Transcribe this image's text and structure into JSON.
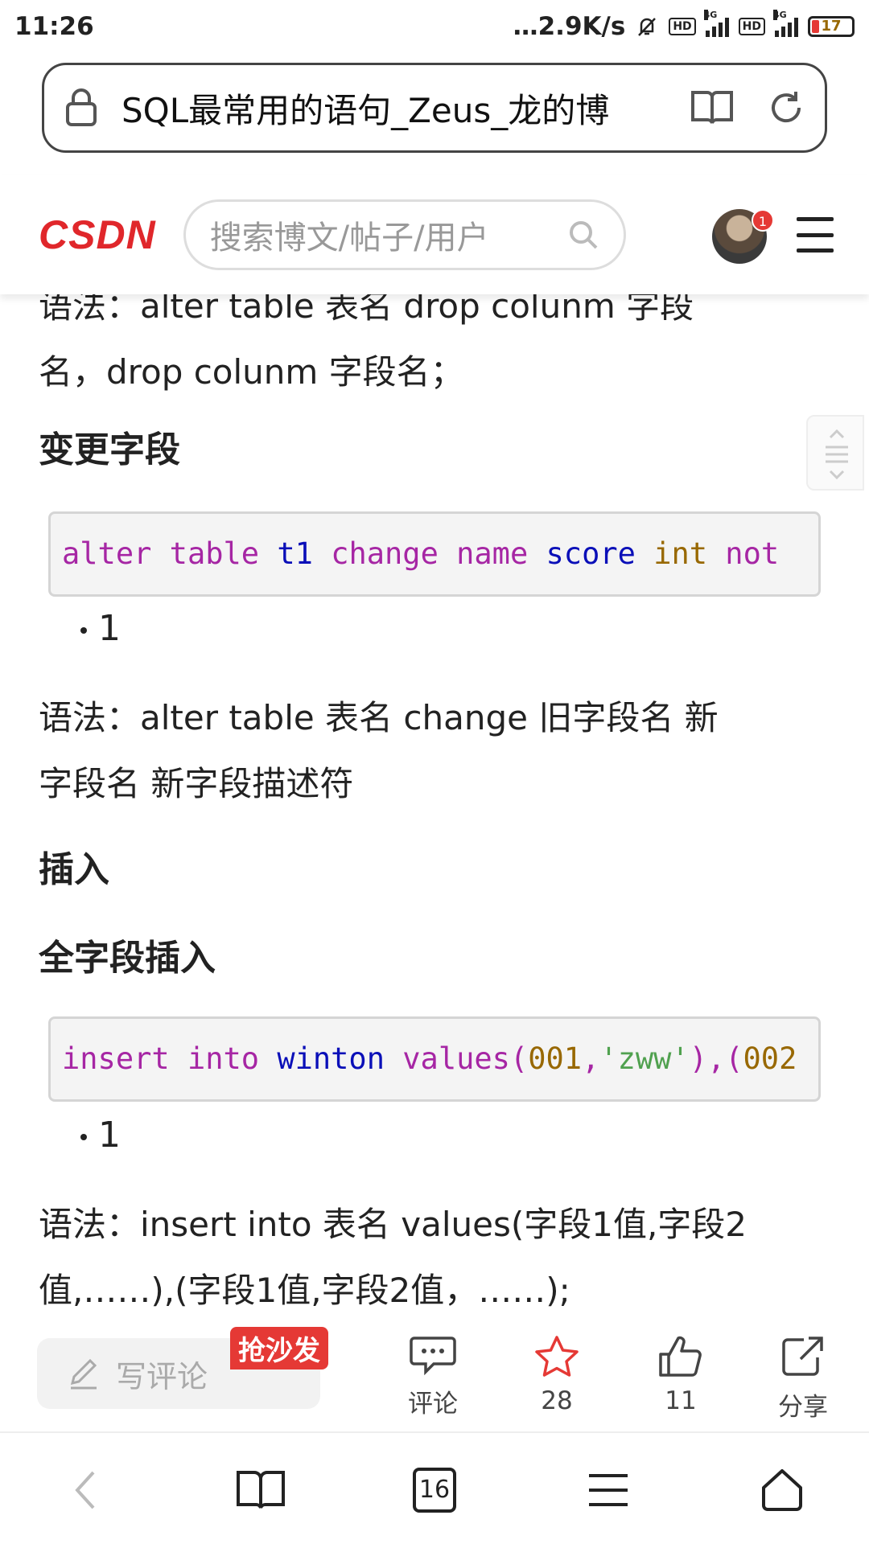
{
  "status_bar": {
    "time": "11:26",
    "net_speed": "2.9K/s",
    "hd1": "HD",
    "hd2": "HD",
    "net1": "4G",
    "net2": "4G",
    "battery": "17"
  },
  "browser": {
    "url_title": "SQL最常用的语句_Zeus_龙的博"
  },
  "csdn": {
    "logo": "CSDN",
    "search_placeholder": "搜索博文/帖子/用户",
    "notification_count": "1"
  },
  "article": {
    "drop_syntax_line1": "语法：alter table 表名 drop colunm 字段",
    "drop_syntax_line2": "名，drop colunm 字段名；",
    "heading_change": "变更字段",
    "code_change": {
      "t1": "alter",
      "t2": "table",
      "t3": "t1",
      "t4": "change",
      "t5": "name",
      "t6": "score",
      "t7": "int",
      "t8": "not"
    },
    "code_change_line": "1",
    "change_syntax_line1": "语法：alter table 表名 change 旧字段名 新",
    "change_syntax_line2": "字段名 新字段描述符",
    "heading_insert": "插入",
    "heading_full_insert": "全字段插入",
    "code_insert": {
      "t1": "insert",
      "t2": "into",
      "t3": "winton",
      "t4": "values",
      "t5": "(",
      "t6": "001",
      "t7": ",",
      "t8": "'zww'",
      "t9": "),(",
      "t10": "002"
    },
    "code_insert_line": "1",
    "insert_syntax_line1": "语法：insert into 表名 values(字段1值,字段2",
    "insert_syntax_line2": "值,……),(字段1值,字段2值，……);"
  },
  "action_bar": {
    "comment_placeholder": "写评论",
    "sofa_badge": "抢沙发",
    "comment_label": "评论",
    "star_count": "28",
    "like_count": "11",
    "share_label": "分享"
  },
  "nav_bar": {
    "tab_count": "16"
  },
  "colors": {
    "brand_red": "#e0272b",
    "keyword": "#a626a4",
    "identifier": "#0a0fb8",
    "number": "#986801",
    "string": "#50a14f"
  }
}
